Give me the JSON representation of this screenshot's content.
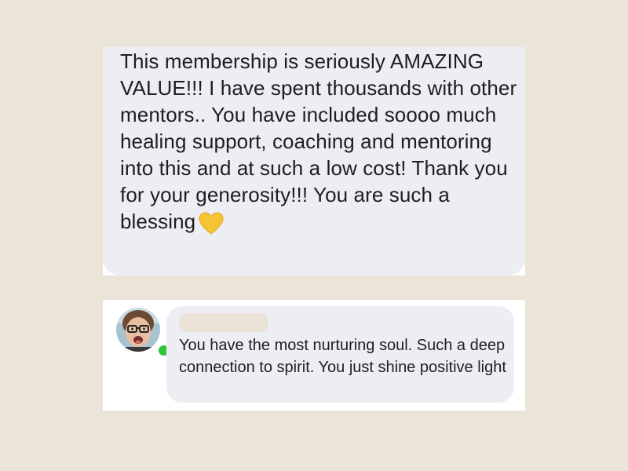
{
  "testimonial": {
    "message": "This membership is seriously AMAZING VALUE!!! I have spent thousands with other mentors.. You have included soooo much healing support, coaching and mentoring into this and at such a low cost! Thank you for your generosity!!! You are such a blessing",
    "emoji": "yellow-heart-icon"
  },
  "comment": {
    "author_name": "",
    "text": "You have the most nurturing soul. Such a deep connection to spirit. You just shine positive light",
    "author_online": true
  },
  "colors": {
    "page_background": "#ebe4d8",
    "bubble_background": "#eceef3",
    "card_background": "#ffffff",
    "text": "#1c1e21",
    "online_indicator": "#31c43a",
    "heart": "#f7c431"
  }
}
